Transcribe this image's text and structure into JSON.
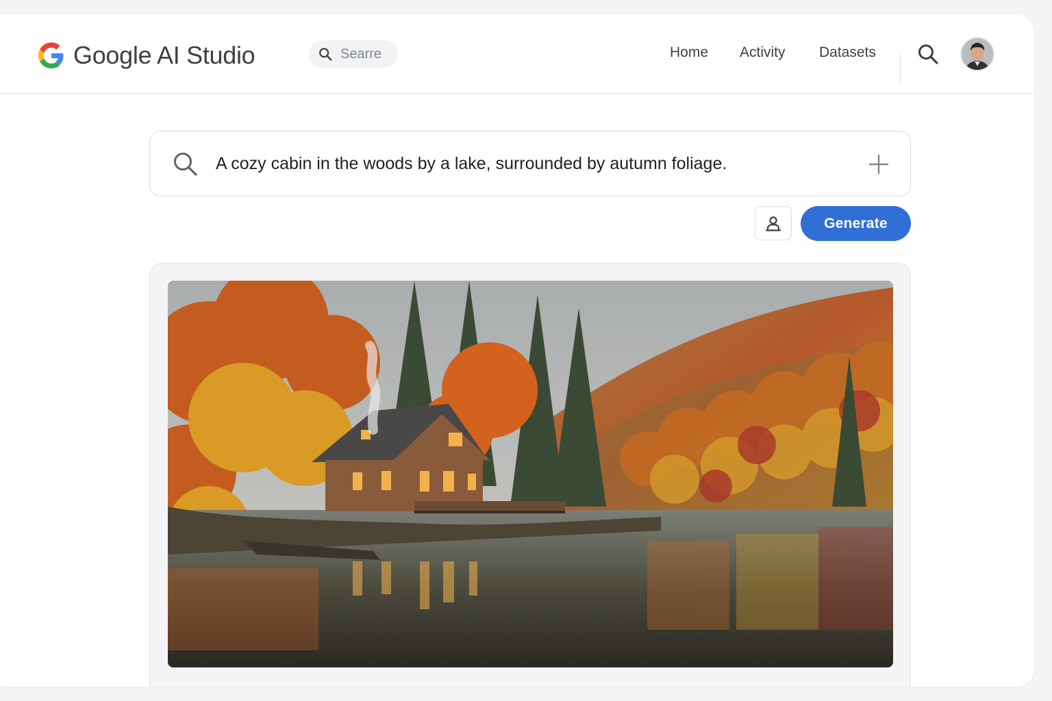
{
  "app": {
    "name": "Google AI Studio"
  },
  "header": {
    "search_placeholder": "Searre",
    "nav": [
      {
        "label": "Home"
      },
      {
        "label": "Activity"
      },
      {
        "label": "Datasets"
      }
    ]
  },
  "prompt": {
    "value": "A cozy cabin in the woods by a lake, surrounded by autumn foliage."
  },
  "actions": {
    "generate_label": "Generate"
  },
  "colors": {
    "accent": "#2f6fd6",
    "google_blue": "#4285f4",
    "google_red": "#ea4335",
    "google_yellow": "#fbbc05",
    "google_green": "#34a853"
  },
  "icons": {
    "logo": "google-g-icon",
    "mini_search": "search-icon",
    "header_search": "search-icon",
    "prompt_search": "search-icon",
    "add": "plus-icon",
    "reference": "person-icon"
  }
}
